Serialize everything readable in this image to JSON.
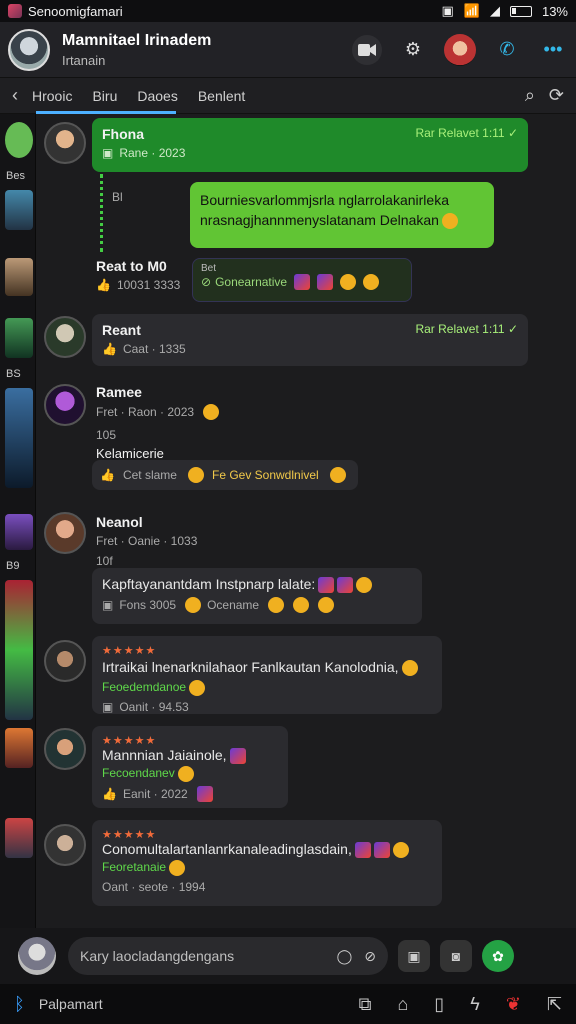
{
  "status_bar": {
    "app_name": "Senoomigfamari",
    "battery": "13%"
  },
  "header": {
    "title": "Mamnitael Irinadem",
    "subtitle": "Irtanain"
  },
  "tabs": {
    "items": [
      "Hrooic",
      "Biru",
      "Daoes",
      "Benlent"
    ]
  },
  "rail": {
    "labels": [
      "Bes",
      "BS",
      "B9"
    ]
  },
  "messages": [
    {
      "name": "Fhona",
      "meta": "Rane · 2023",
      "status": "Rar Relavet 1:11 ✓"
    },
    {
      "line": "Bl"
    },
    {
      "text": "Bourniesvarlommjsrla nglarrolakanirleka nrasnagjhannmenyslatanam Delnakan"
    },
    {
      "name": "Reat to M0",
      "sub": "Bet",
      "meta": "Gonearnative",
      "time": "10031 3333"
    },
    {
      "name": "Reant",
      "meta": "Caat · 1335",
      "status": "Rar Relavet 1:11 ✓"
    },
    {
      "name": "Ramee",
      "meta": "Fret · Raon · 2023",
      "line2": "Kelamicerie",
      "react": "Cet slame",
      "green": "Fe Gev Sonwdlnivel",
      "extra": "105"
    },
    {
      "name": "Neanol",
      "meta": "Fret · Oanie · 1033",
      "extra": "10f",
      "text": "Kapftayanantdam Instpnarp lalate:",
      "react": "Fons 3005",
      "react2": "Ocename"
    },
    {
      "text": "Irtraikai lnenarknilahaor Fanlkautan Kanolodnia,",
      "green": "Feoedemdanoe",
      "meta": "Oanit · 94.53"
    },
    {
      "text": "Mannnian Jaiainole,",
      "green": "Fecoendanev",
      "meta": "Eanit · 2022"
    },
    {
      "text": "Conomultalartanlanrkanaleadinglasdain,",
      "green": "Feoretanaie",
      "meta": "Oant · seote · 1994"
    }
  ],
  "composer": {
    "placeholder": "Kary laocladangdengans",
    "me_label": ""
  },
  "nav": {
    "label": "Palpamart"
  }
}
